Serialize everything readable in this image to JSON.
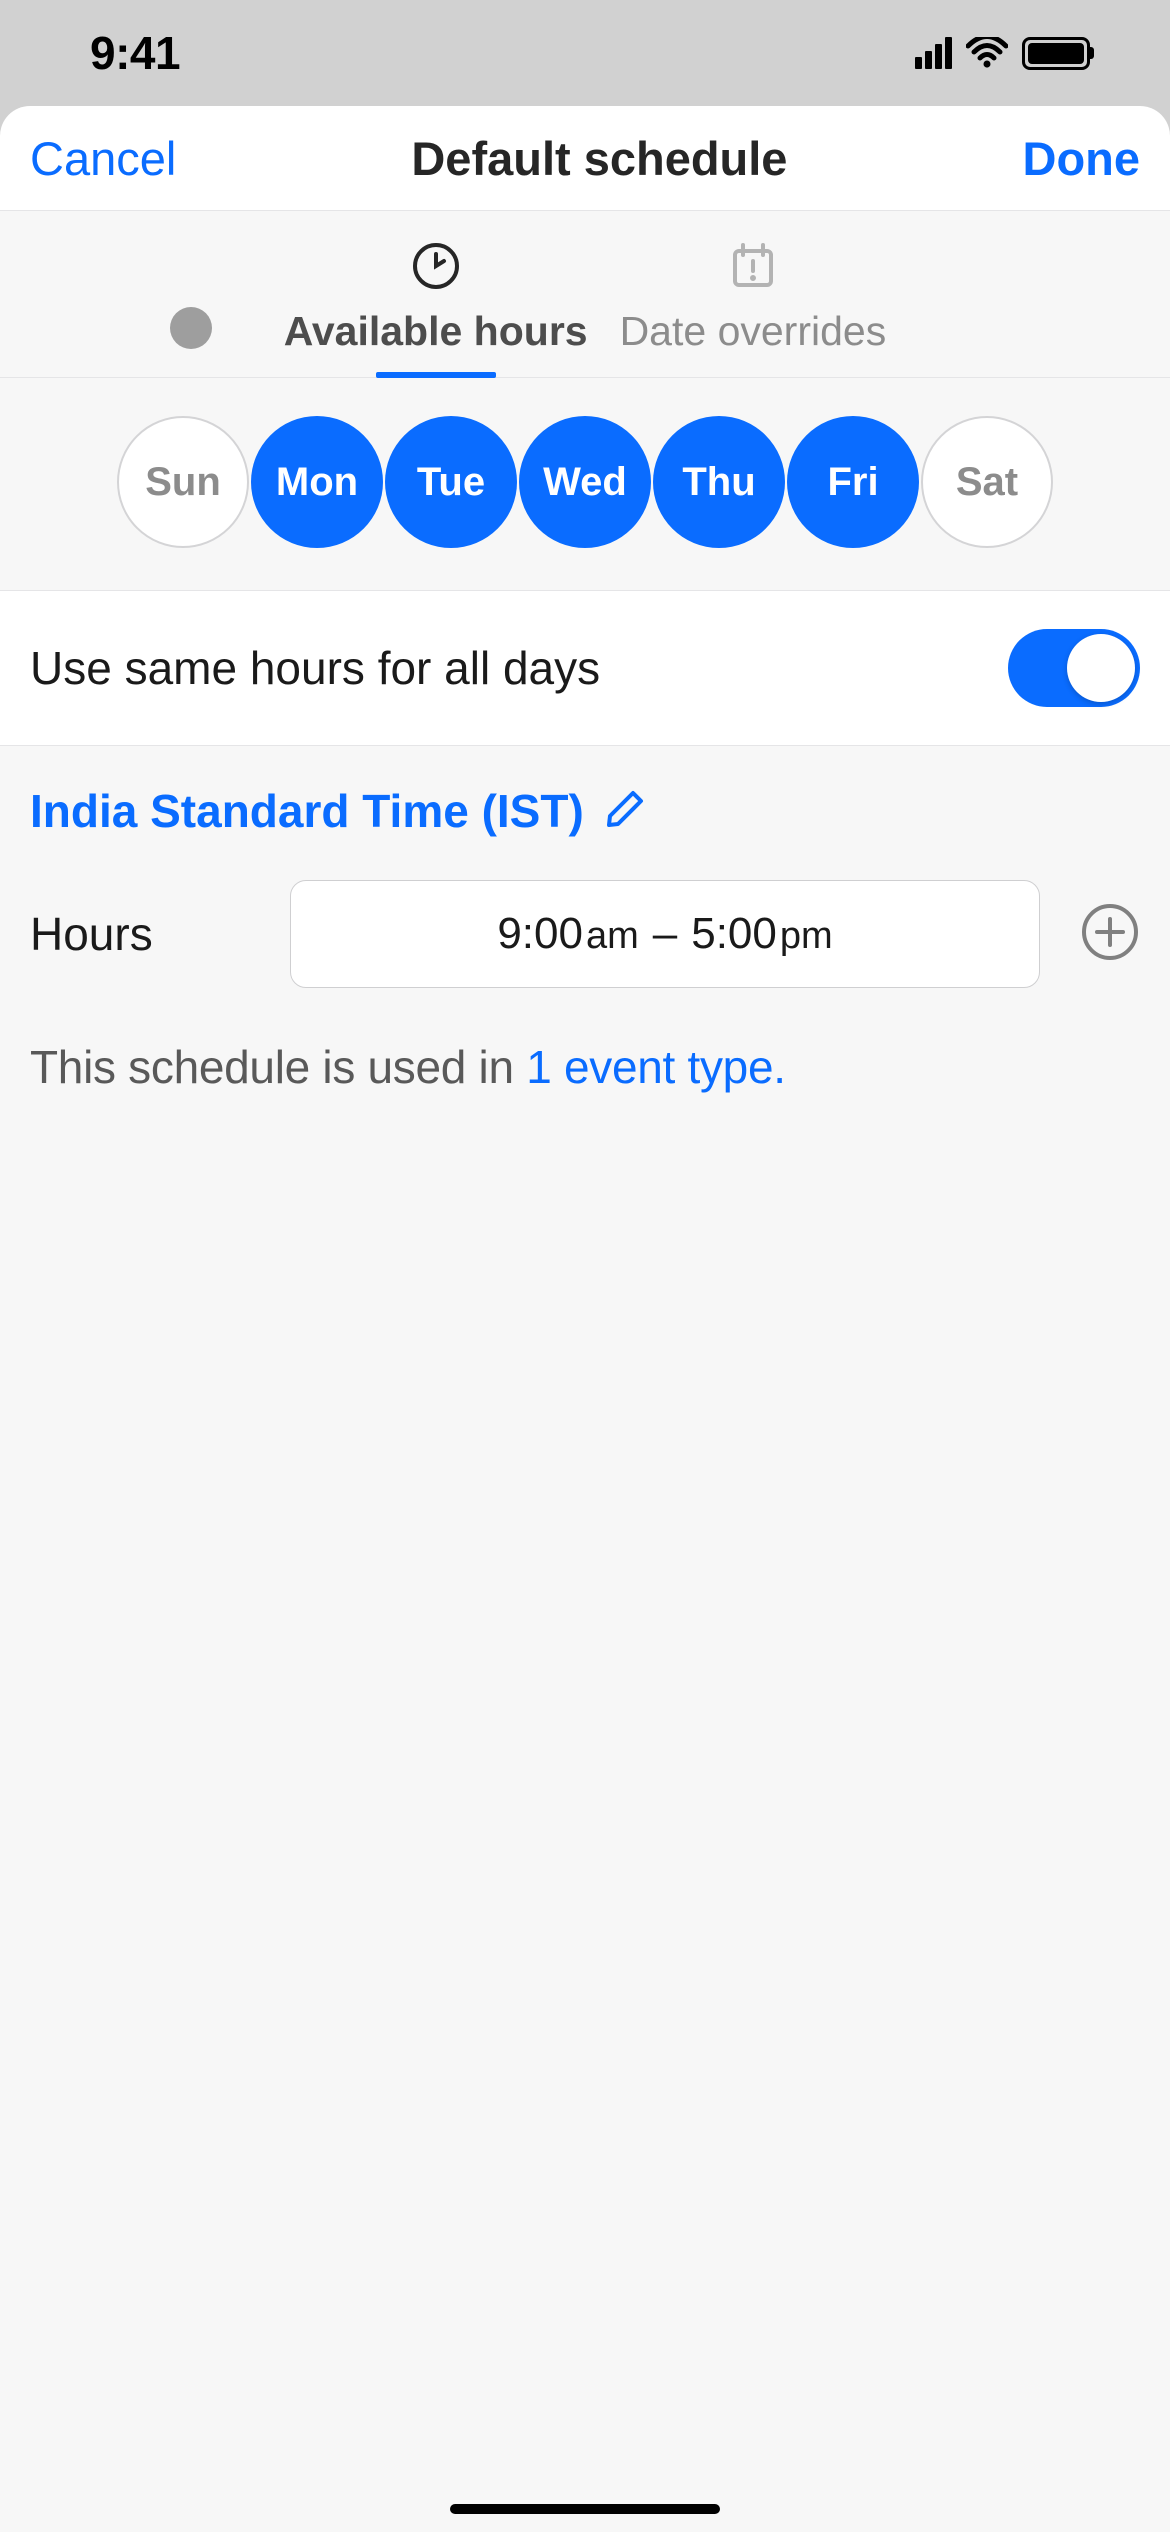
{
  "status": {
    "time": "9:41"
  },
  "nav": {
    "cancel": "Cancel",
    "title": "Default schedule",
    "done": "Done"
  },
  "tabs": {
    "available": "Available hours",
    "overrides": "Date overrides"
  },
  "days": {
    "sun": "Sun",
    "mon": "Mon",
    "tue": "Tue",
    "wed": "Wed",
    "thu": "Thu",
    "fri": "Fri",
    "sat": "Sat"
  },
  "toggle": {
    "label": "Use same hours for all days",
    "on": true
  },
  "timezone": {
    "label": "India Standard Time (IST)"
  },
  "hours": {
    "label": "Hours",
    "start_time": "9:00",
    "start_unit": "am",
    "dash": "–",
    "end_time": "5:00",
    "end_unit": "pm"
  },
  "footer": {
    "prefix": "This schedule is used in ",
    "link": "1 event type."
  }
}
